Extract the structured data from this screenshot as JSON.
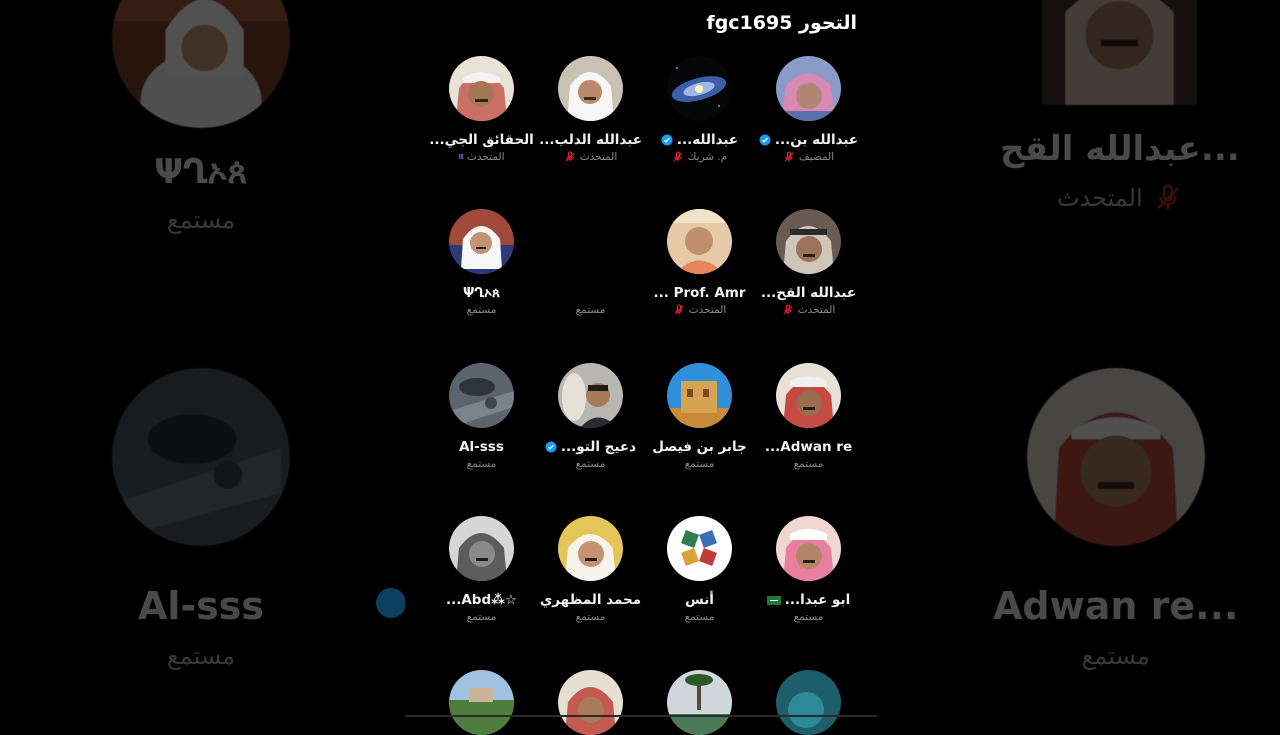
{
  "space": {
    "title": "fgc1695 التحور"
  },
  "participants": [
    {
      "name": "عبدالله بن...",
      "role": "المضيف",
      "verified": true,
      "muted": true,
      "avatar": "person-pink-headscarf"
    },
    {
      "name": "عبدالله...",
      "role": "م. شريك",
      "verified": true,
      "muted": true,
      "avatar": "galaxy"
    },
    {
      "name": "عبدالله الدلب...",
      "role": "المتحدث",
      "verified": false,
      "muted": true,
      "avatar": "person-white-ghutra"
    },
    {
      "name": "الحقائق الجي...",
      "role": "المتحدث",
      "verified": false,
      "muted": false,
      "speaking": true,
      "avatar": "person-red-ghutra"
    },
    {
      "name": "عبدالله القح...",
      "role": "المتحدث",
      "verified": false,
      "muted": true,
      "avatar": "person-shemagh"
    },
    {
      "name": "Prof. Amr ...",
      "role": "المتحدث",
      "verified": false,
      "muted": true,
      "avatar": "person-orange"
    },
    {
      "name": "",
      "role": "مستمع",
      "verified": false,
      "muted": false,
      "avatar": "none"
    },
    {
      "name": "ΨՂኦጰ",
      "role": "مستمع",
      "verified": false,
      "muted": false,
      "avatar": "person-white-mic"
    },
    {
      "name": "Adwan re...",
      "role": "مستمع",
      "verified": false,
      "muted": false,
      "avatar": "person-red-shemagh"
    },
    {
      "name": "جابر بن فيصل",
      "role": "مستمع",
      "verified": false,
      "muted": false,
      "avatar": "building"
    },
    {
      "name": "دعيج التو...",
      "role": "مستمع",
      "verified": true,
      "muted": false,
      "avatar": "person-camel"
    },
    {
      "name": "Al-sss",
      "role": "مستمع",
      "verified": false,
      "muted": false,
      "avatar": "jet"
    },
    {
      "name": "ابو عبدا...",
      "role": "مستمع",
      "verified": false,
      "muted": false,
      "flag": true,
      "avatar": "person-pink-shemagh"
    },
    {
      "name": "أنس",
      "role": "مستمع",
      "verified": false,
      "muted": false,
      "avatar": "logo-star"
    },
    {
      "name": "محمد المظهري",
      "role": "مستمع",
      "verified": false,
      "muted": false,
      "avatar": "person-beige"
    },
    {
      "name": "☆⁂Abd...",
      "role": "مستمع",
      "verified": false,
      "muted": false,
      "avatar": "person-gray"
    },
    {
      "name": "",
      "role": "",
      "avatar": "landscape"
    },
    {
      "name": "",
      "role": "",
      "avatar": "person-shemagh-2"
    },
    {
      "name": "",
      "role": "",
      "avatar": "palm"
    },
    {
      "name": "",
      "role": "",
      "avatar": "teal"
    }
  ],
  "background": {
    "left": [
      {
        "name": "ΨՂኦጰ",
        "role": "مستمع",
        "avatar": "person-white-mic"
      },
      {
        "name": "Al-sss",
        "role": "مستمع",
        "avatar": "jet"
      }
    ],
    "right": [
      {
        "name": "عبدالله القح...",
        "role": "المتحدث",
        "avatar": "person-shemagh"
      },
      {
        "name": "Adwan re...",
        "role": "مستمع",
        "avatar": "person-red-shemagh"
      }
    ]
  },
  "colors": {
    "background": "#000000",
    "verified": "#1d9bf0",
    "muted_mic": "#f4212e",
    "text_primary": "#f2f2f2",
    "text_secondary": "#8a8a8a"
  },
  "icons": {
    "verified": "verified-badge-icon",
    "muted": "mic-off-icon",
    "speaking": "speaking-bars-icon",
    "flag": "saudi-flag-icon"
  }
}
